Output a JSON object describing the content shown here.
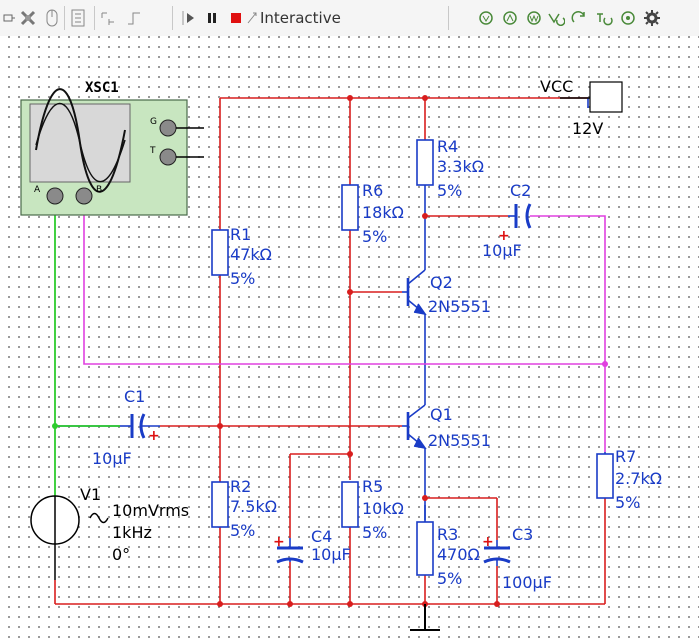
{
  "toolbar": {
    "mode_label": "Interactive",
    "icons": [
      "component-icon",
      "probe-icon",
      "mouse-icon",
      "meter-icon",
      "grapher-icon",
      "step-icon",
      "play-icon",
      "pause-icon",
      "stop-icon",
      "interactive-icon",
      "sim-1-icon",
      "sim-2-icon",
      "sim-3-icon",
      "sim-4-icon",
      "sim-5-icon",
      "sim-6-icon",
      "sim-7-icon",
      "gear-icon"
    ]
  },
  "oscilloscope": {
    "name": "XSC1",
    "pins": {
      "a": "A",
      "b": "B",
      "g": "G",
      "t": "T"
    }
  },
  "supply": {
    "name": "VCC",
    "value": "12V"
  },
  "source": {
    "name": "V1",
    "amplitude": "10mVrms",
    "frequency": "1kHz",
    "phase": "0°"
  },
  "components": {
    "r1": {
      "name": "R1",
      "value": "47kΩ",
      "tol": "5%"
    },
    "r2": {
      "name": "R2",
      "value": "7.5kΩ",
      "tol": "5%"
    },
    "r3": {
      "name": "R3",
      "value": "470Ω",
      "tol": "5%"
    },
    "r4": {
      "name": "R4",
      "value": "3.3kΩ",
      "tol": "5%"
    },
    "r5": {
      "name": "R5",
      "value": "10kΩ",
      "tol": "5%"
    },
    "r6": {
      "name": "R6",
      "value": "18kΩ",
      "tol": "5%"
    },
    "r7": {
      "name": "R7",
      "value": "2.7kΩ",
      "tol": "5%"
    },
    "c1": {
      "name": "C1",
      "value": "10µF"
    },
    "c2": {
      "name": "C2",
      "value": "10µF"
    },
    "c3": {
      "name": "C3",
      "value": "100µF"
    },
    "c4": {
      "name": "C4",
      "value": "10µF"
    },
    "q1": {
      "name": "Q1",
      "model": "2N5551"
    },
    "q2": {
      "name": "Q2",
      "model": "2N5551"
    }
  },
  "polarity_mark": "+",
  "colors": {
    "wire_red": "#d81e1e",
    "wire_green": "#2ecc2e",
    "wire_magenta": "#e040e0",
    "component": "#1a3cc7",
    "scope_body": "#c8e6c0"
  }
}
